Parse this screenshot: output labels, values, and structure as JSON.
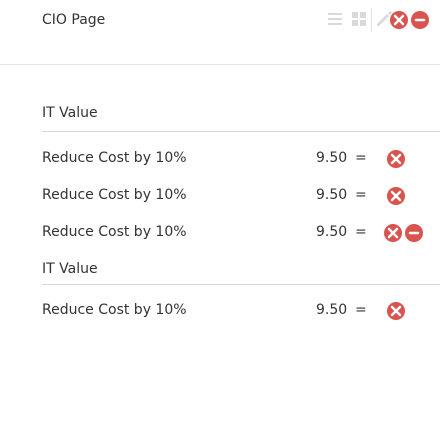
{
  "header": {
    "title": "CIO Page",
    "toolbar": [
      {
        "icon": "list-icon"
      },
      {
        "icon": "grid-icon"
      },
      {
        "icon": "edit-icon"
      }
    ],
    "status_icon": "status-icon-pair"
  },
  "sections": [
    {
      "title": "IT Value",
      "rows": [
        {
          "label": "Reduce Cost by 10%",
          "value": "9.50",
          "operator": "=",
          "status": "error"
        },
        {
          "label": "Reduce Cost by 10%",
          "value": "9.50",
          "operator": "=",
          "status": "error"
        },
        {
          "label": "Reduce Cost by 10%",
          "value": "9.50",
          "operator": "=",
          "status": "error-pair"
        }
      ]
    },
    {
      "title": "IT Value",
      "rows": [
        {
          "label": "Reduce Cost by 10%",
          "value": "9.50",
          "operator": "=",
          "status": "error"
        }
      ]
    }
  ],
  "colors": {
    "error": "#d9534f",
    "error_bg": "#ffffff",
    "text": "#333333",
    "line": "#d8d8d8"
  }
}
